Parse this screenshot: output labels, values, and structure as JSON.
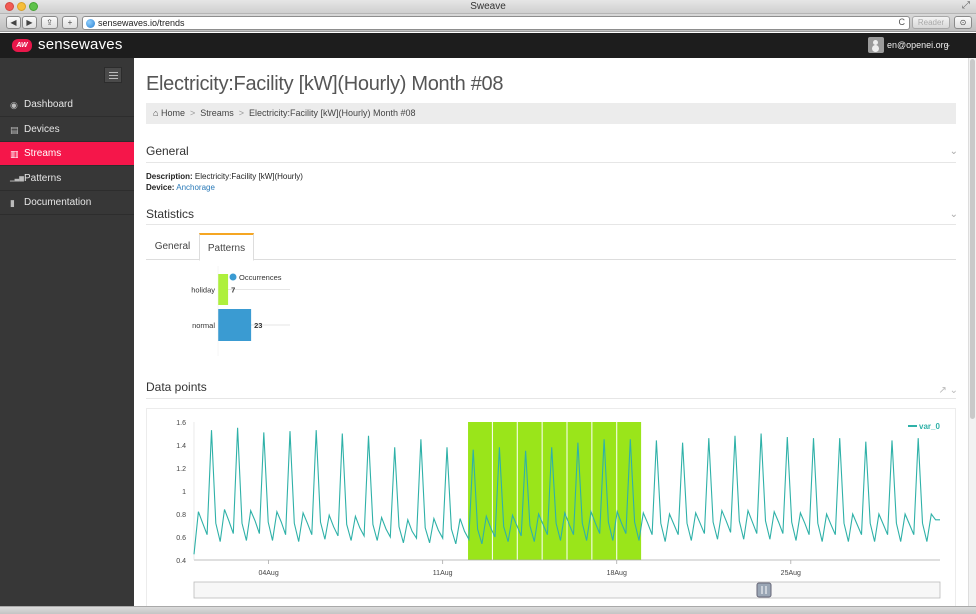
{
  "window": {
    "title": "Sweave"
  },
  "browser": {
    "url": "sensewaves.io/trends",
    "reader_label": "Reader",
    "back_glyph": "◀",
    "forward_glyph": "▶",
    "share_glyph": "⇪",
    "add_glyph": "+",
    "reload_glyph": "C",
    "download_glyph": "⊙",
    "resize_glyph": "⤢"
  },
  "app": {
    "logo_badge": "AW",
    "brand": "sensewaves",
    "user_email": "en@openei.org",
    "user_caret": "⌄"
  },
  "sidebar": {
    "items": [
      {
        "label": "Dashboard",
        "icon": "dashboard-icon",
        "glyph": "◉",
        "active": false
      },
      {
        "label": "Devices",
        "icon": "devices-icon",
        "glyph": "▤",
        "active": false
      },
      {
        "label": "Streams",
        "icon": "streams-icon",
        "glyph": "▥",
        "active": true
      },
      {
        "label": "Patterns",
        "icon": "patterns-icon",
        "glyph": "▁▃▆",
        "active": false
      },
      {
        "label": "Documentation",
        "icon": "documentation-icon",
        "glyph": "▮",
        "active": false
      }
    ]
  },
  "page": {
    "title": "Electricity:Facility [kW](Hourly) Month #08",
    "breadcrumb": {
      "home_glyph": "⌂",
      "items": [
        "Home",
        "Streams",
        "Electricity:Facility [kW](Hourly) Month #08"
      ],
      "sep": ">"
    },
    "general": {
      "heading": "General",
      "description_label": "Description:",
      "description_value": "Electricity:Facility [kW](Hourly)",
      "device_label": "Device:",
      "device_value": "Anchorage"
    },
    "statistics": {
      "heading": "Statistics",
      "tabs": [
        "General",
        "Patterns"
      ],
      "active_tab": "Patterns"
    },
    "data_points": {
      "heading": "Data points",
      "pin_glyph": "↗"
    },
    "chevron_glyph": "⌄"
  },
  "colors": {
    "accent": "#f5164a",
    "holiday_bar": "#aef03c",
    "normal_bar": "#3a9bd2",
    "series_line": "#2fb1a8",
    "pattern_highlight": "#9ae51a"
  },
  "chart_data": [
    {
      "type": "bar",
      "orientation": "horizontal",
      "legend": [
        "Occurrences"
      ],
      "legend_placement": "top",
      "categories": [
        "holiday",
        "normal"
      ],
      "series": [
        {
          "name": "Occurrences",
          "values": [
            7,
            23
          ]
        }
      ],
      "data_labels": [
        "7",
        "23"
      ],
      "xlim": [
        0,
        50
      ]
    },
    {
      "type": "line",
      "legend": [
        "var_0"
      ],
      "legend_placement": "top-right",
      "ylim": [
        0.4,
        1.6
      ],
      "yticks": [
        0.4,
        0.6,
        0.8,
        1,
        1.2,
        1.4,
        1.6
      ],
      "ytick_labels": [
        "0.4",
        "0.6",
        "0.8",
        "1",
        "1.2",
        "1.4",
        "1.6"
      ],
      "x_start_day": 1,
      "x_end_day": 31,
      "xtick_labels": [
        "04Aug",
        "11Aug",
        "18Aug",
        "25Aug"
      ],
      "xtick_days": [
        4,
        11,
        18,
        25
      ],
      "highlight_range_days": [
        12,
        19
      ],
      "highlight_days_count": 7,
      "series": [
        {
          "name": "var_0",
          "values": [
            0.45,
            0.82,
            0.72,
            0.62,
            1.53,
            0.72,
            0.56,
            0.84,
            0.74,
            0.63,
            1.55,
            0.72,
            0.57,
            0.83,
            0.74,
            0.63,
            1.51,
            0.73,
            0.57,
            0.82,
            0.73,
            0.62,
            1.52,
            0.72,
            0.56,
            0.81,
            0.72,
            0.62,
            1.53,
            0.73,
            0.58,
            0.79,
            0.69,
            0.61,
            1.5,
            0.71,
            0.57,
            0.78,
            0.68,
            0.61,
            1.48,
            0.71,
            0.57,
            0.77,
            0.67,
            0.6,
            1.38,
            0.69,
            0.55,
            0.75,
            0.65,
            0.59,
            1.45,
            0.68,
            0.55,
            0.76,
            0.66,
            0.59,
            1.38,
            0.67,
            0.54,
            0.76,
            0.65,
            0.58,
            1.36,
            0.67,
            0.54,
            0.78,
            0.68,
            0.6,
            1.38,
            0.69,
            0.56,
            0.79,
            0.7,
            0.61,
            1.35,
            0.7,
            0.56,
            0.8,
            0.71,
            0.62,
            1.38,
            0.72,
            0.57,
            0.81,
            0.71,
            0.62,
            1.42,
            0.72,
            0.57,
            0.82,
            0.72,
            0.63,
            1.45,
            0.73,
            0.57,
            0.82,
            0.72,
            0.63,
            1.45,
            0.73,
            0.57,
            0.81,
            0.72,
            0.62,
            1.44,
            0.72,
            0.56,
            0.8,
            0.71,
            0.62,
            1.42,
            0.72,
            0.57,
            0.81,
            0.72,
            0.63,
            1.46,
            0.73,
            0.58,
            0.83,
            0.74,
            0.64,
            1.48,
            0.74,
            0.58,
            0.83,
            0.73,
            0.63,
            1.5,
            0.74,
            0.58,
            0.82,
            0.73,
            0.63,
            1.47,
            0.73,
            0.57,
            0.81,
            0.72,
            0.62,
            1.46,
            0.72,
            0.56,
            0.8,
            0.71,
            0.62,
            1.46,
            0.72,
            0.56,
            0.8,
            0.71,
            0.62,
            1.43,
            0.72,
            0.56,
            0.8,
            0.71,
            0.62,
            1.44,
            0.72,
            0.56,
            0.8,
            0.71,
            0.62,
            1.46,
            0.72,
            0.56,
            0.8,
            0.75,
            0.75
          ]
        }
      ]
    }
  ]
}
